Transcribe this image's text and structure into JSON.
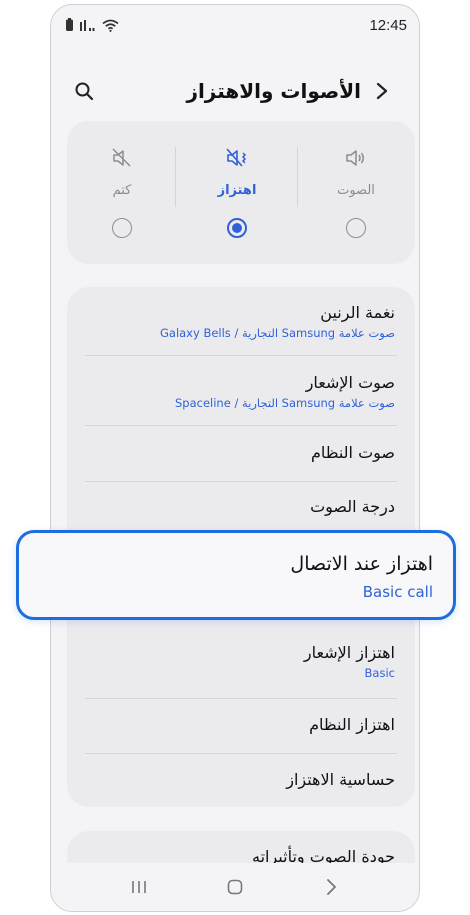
{
  "status_bar": {
    "time": "12:45"
  },
  "header": {
    "title": "الأصوات والاهتزاز"
  },
  "sound_modes": [
    {
      "label": "الصوت",
      "icon": "speaker-icon",
      "selected": false
    },
    {
      "label": "اهتزاز",
      "icon": "vibrate-icon",
      "selected": true
    },
    {
      "label": "كتم",
      "icon": "mute-icon",
      "selected": false
    }
  ],
  "settings": {
    "ringtone": {
      "title": "نغمة الرنين",
      "value": "صوت علامة Samsung التجارية / Galaxy Bells"
    },
    "notification_sound": {
      "title": "صوت الإشعار",
      "value": "صوت علامة Samsung التجارية / Spaceline"
    },
    "system_sound": {
      "title": "صوت النظام"
    },
    "volume": {
      "title": "درجة الصوت"
    },
    "call_vibration": {
      "title": "اهتزاز عند الاتصال",
      "value": "Basic call"
    },
    "notification_vibration": {
      "title": "اهتزاز الإشعار",
      "value": "Basic"
    },
    "system_vibration": {
      "title": "اهتزاز النظام"
    },
    "vibration_intensity": {
      "title": "حساسية الاهتزاز"
    },
    "sound_quality": {
      "title": "جودة الصوت وتأثيراته"
    }
  },
  "colors": {
    "accent": "#2f62d8",
    "highlight_border": "#1c6ee0",
    "card": "#ebebee"
  }
}
